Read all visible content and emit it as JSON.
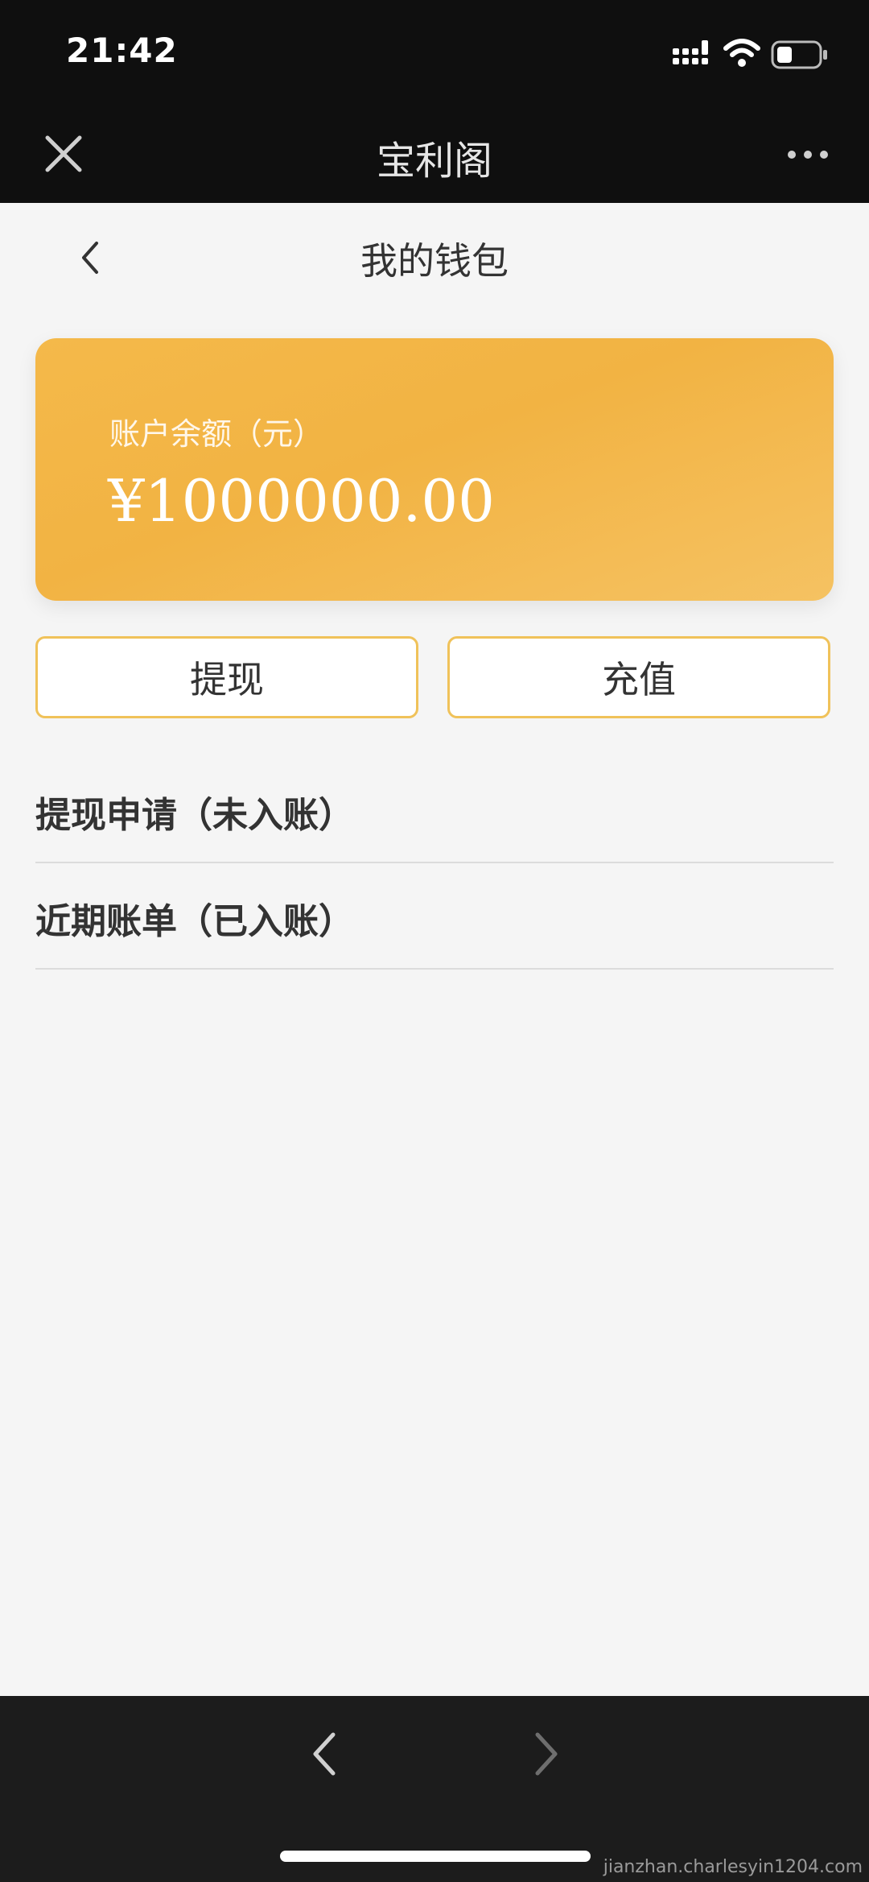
{
  "status_bar": {
    "time": "21:42"
  },
  "web_bar": {
    "title": "宝利阁"
  },
  "page": {
    "title": "我的钱包"
  },
  "balance": {
    "label": "账户余额（元）",
    "amount": "¥1000000.00"
  },
  "actions": {
    "withdraw": "提现",
    "recharge": "充值"
  },
  "list": [
    {
      "label": "提现申请（未入账）"
    },
    {
      "label": "近期账单（已入账）"
    }
  ],
  "watermark": "jianzhan.charlesyin1204.com",
  "colors": {
    "accent": "#f2b343",
    "button_border": "#f0c25a",
    "bar_bg": "#0f0f0f"
  }
}
